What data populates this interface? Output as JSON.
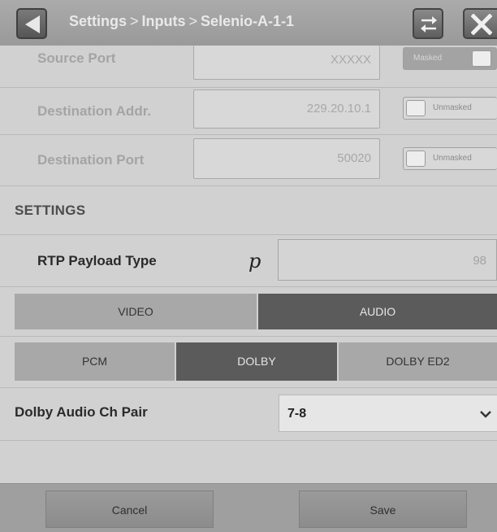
{
  "header": {
    "breadcrumb": [
      "Settings",
      "Inputs",
      "Selenio-A-1-1"
    ],
    "separator": ">"
  },
  "fields": [
    {
      "label": "Source Port",
      "value": "XXXXX",
      "toggle": "Masked",
      "toggle_on": true
    },
    {
      "label": "Destination Addr.",
      "value": "229.20.10.1",
      "toggle": "Unmasked",
      "toggle_on": false
    },
    {
      "label": "Destination Port",
      "value": "50020",
      "toggle": "Unmasked",
      "toggle_on": false
    }
  ],
  "settings": {
    "heading": "SETTINGS",
    "rtp_label": "RTP Payload Type",
    "rtp_marker": "p",
    "rtp_value": "98",
    "format_tabs": [
      {
        "label": "VIDEO",
        "selected": false
      },
      {
        "label": "AUDIO",
        "selected": true
      }
    ],
    "audio_tabs": [
      {
        "label": "PCM",
        "selected": false
      },
      {
        "label": "DOLBY",
        "selected": true
      },
      {
        "label": "DOLBY ED2",
        "selected": false
      }
    ],
    "dolby_label": "Dolby Audio Ch Pair",
    "dolby_value": "7-8"
  },
  "footer": {
    "cancel": "Cancel",
    "save": "Save"
  },
  "icons": {
    "back": "back-arrow-icon",
    "swap": "swap-arrows-icon",
    "close": "close-x-icon",
    "dropdown": "chevron-down-icon"
  }
}
